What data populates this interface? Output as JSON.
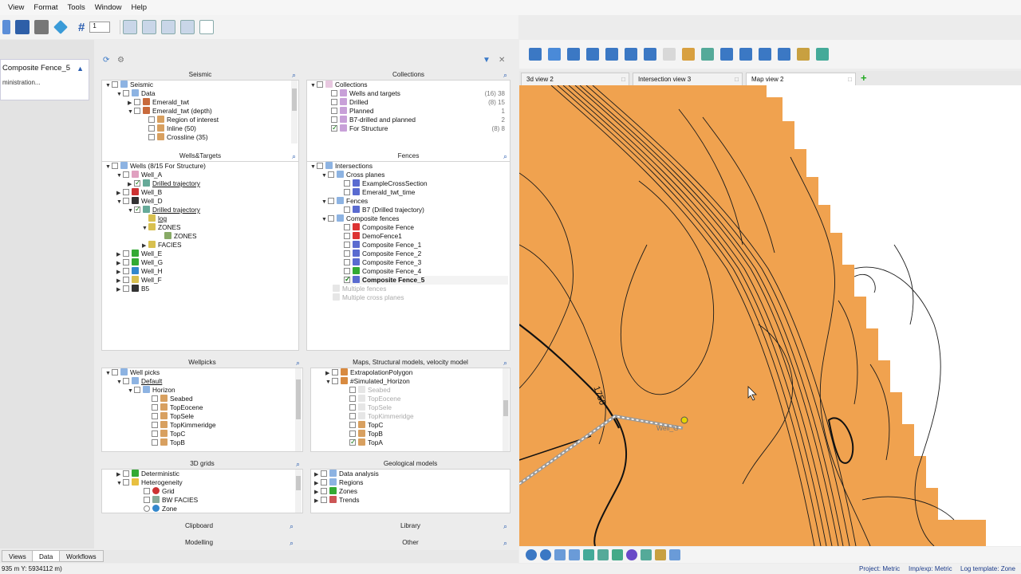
{
  "menu": [
    "View",
    "Format",
    "Tools",
    "Window",
    "Help"
  ],
  "toolbar": {
    "spinner_value": "1"
  },
  "left_card": {
    "title": "Composite Fence_5",
    "subtitle": "ministration..."
  },
  "panels": {
    "seismic": {
      "title": "Seismic",
      "rows": [
        "Seismic",
        "Data",
        "Emerald_twt",
        "Emerald_twt (depth)",
        "Region of interest",
        "Inline (50)",
        "Crossline (35)"
      ]
    },
    "collections": {
      "title": "Collections",
      "rows": [
        "Collections",
        "Wells and targets",
        "Drilled",
        "Planned",
        "B7-drilled and planned",
        "For Structure"
      ],
      "counts": [
        "",
        "(16) 38",
        "(8) 15",
        "1",
        "2",
        "(8) 8"
      ]
    },
    "wells": {
      "title": "Wells&Targets",
      "rows": [
        "Wells (8/15 For Structure)",
        "Well_A",
        "Drilled trajectory",
        "Well_B",
        "Well_D",
        "Drilled trajectory",
        "log",
        "ZONES",
        "ZONES",
        "FACIES",
        "Well_E",
        "Well_G",
        "Well_H",
        "Well_F",
        "B5"
      ]
    },
    "fences": {
      "title": "Fences",
      "rows": [
        "Intersections",
        "Cross planes",
        "ExampleCrossSection",
        "Emerald_twt_time",
        "Fences",
        "B7 (Drilled trajectory)",
        "Composite fences",
        "Composite Fence",
        "DemoFence1",
        "Composite Fence_1",
        "Composite Fence_2",
        "Composite Fence_3",
        "Composite Fence_4",
        "Composite Fence_5",
        "Multiple fences",
        "Multiple cross planes"
      ]
    },
    "wellpicks": {
      "title": "Wellpicks",
      "rows": [
        "Well picks",
        "Default",
        "Horizon",
        "Seabed",
        "TopEocene",
        "TopSele",
        "TopKimmeridge",
        "TopC",
        "TopB"
      ]
    },
    "maps": {
      "title": "Maps, Structural models, velocity model",
      "rows": [
        "ExtrapolationPolygon",
        "#Simulated_Horizon",
        "Seabed",
        "TopEocene",
        "TopSele",
        "TopKimmeridge",
        "TopC",
        "TopB",
        "TopA"
      ]
    },
    "grids": {
      "title": "3D grids",
      "rows": [
        "Deterministic",
        "Heterogeneity",
        "Grid",
        "BW FACIES",
        "Zone"
      ]
    },
    "geo": {
      "title": "Geological models",
      "rows": [
        "Data analysis",
        "Regions",
        "Zones",
        "Trends"
      ]
    },
    "clipboard": {
      "title": "Clipboard"
    },
    "library": {
      "title": "Library"
    },
    "modelling": {
      "title": "Modelling"
    },
    "other": {
      "title": "Other"
    }
  },
  "view_tabs": [
    {
      "label": "3d view 2"
    },
    {
      "label": "Intersection view 3"
    },
    {
      "label": "Map view 2"
    }
  ],
  "map": {
    "contour_label": "1750",
    "well_label": "Well_G",
    "fill": "#f0a24f"
  },
  "left_tabs": [
    "Views",
    "Data",
    "Workflows"
  ],
  "status": {
    "coords": "935 m Y: 5934112 m)",
    "project": "Project: Metric",
    "impexp": "Imp/exp: Metric",
    "logtemplate": "Log template: Zone"
  }
}
